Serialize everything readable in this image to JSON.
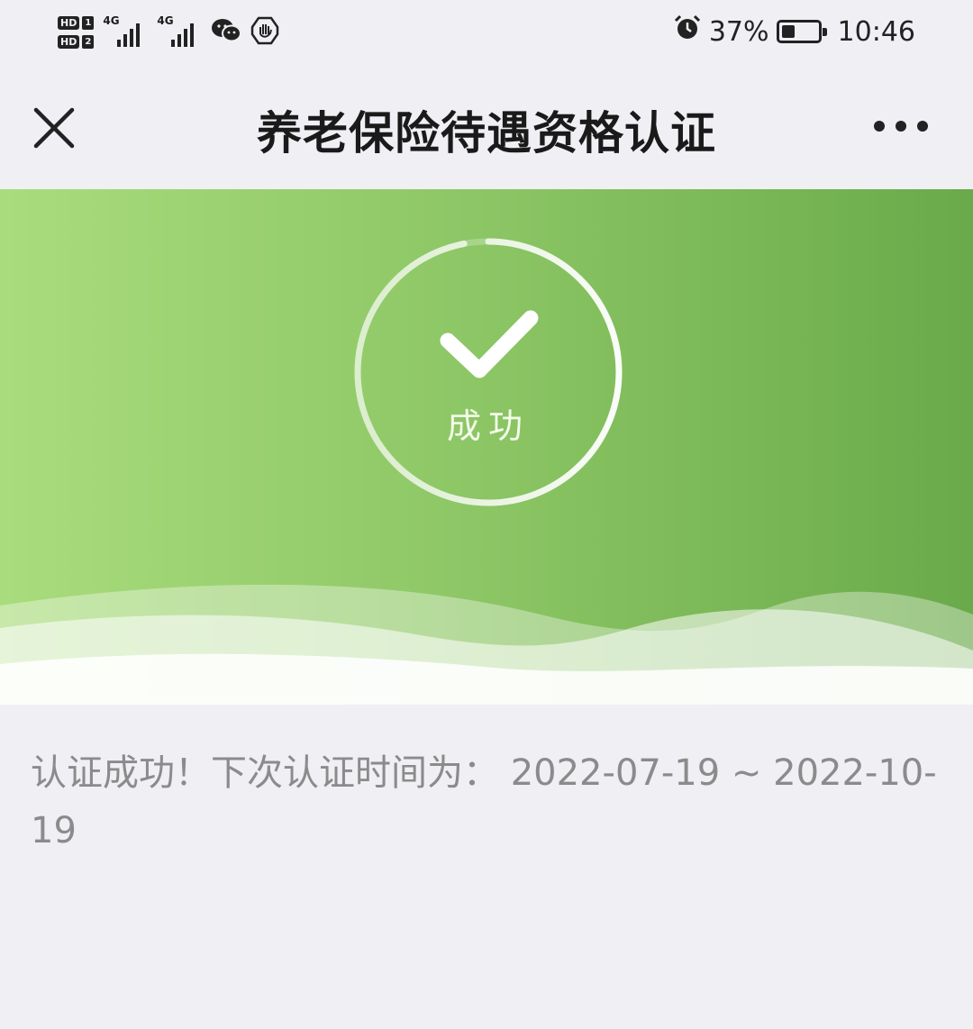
{
  "status_bar": {
    "sim1_label": "HD",
    "sim1_num": "1",
    "sim2_label": "HD",
    "sim2_num": "2",
    "signal1_tag": "4G",
    "signal2_tag": "4G",
    "battery_percent": "37%",
    "battery_level": 0.37,
    "time": "10:46",
    "icons": [
      "wechat-icon",
      "hand-shield-icon",
      "alarm-icon",
      "battery-icon"
    ]
  },
  "nav": {
    "title": "养老保险待遇资格认证",
    "close_icon": "close-icon",
    "more_icon": "more-icon"
  },
  "hero": {
    "status_label": "成功",
    "progress": 0.97,
    "icon": "checkmark-icon"
  },
  "message": {
    "text": "认证成功！下次认证时间为：  2022-07-19 ~ 2022-10-19"
  },
  "colors": {
    "hero_start": "#a9dc7c",
    "hero_end": "#6aaa4a",
    "page_bg": "#efeff4",
    "message_text": "#8b8b8b"
  }
}
